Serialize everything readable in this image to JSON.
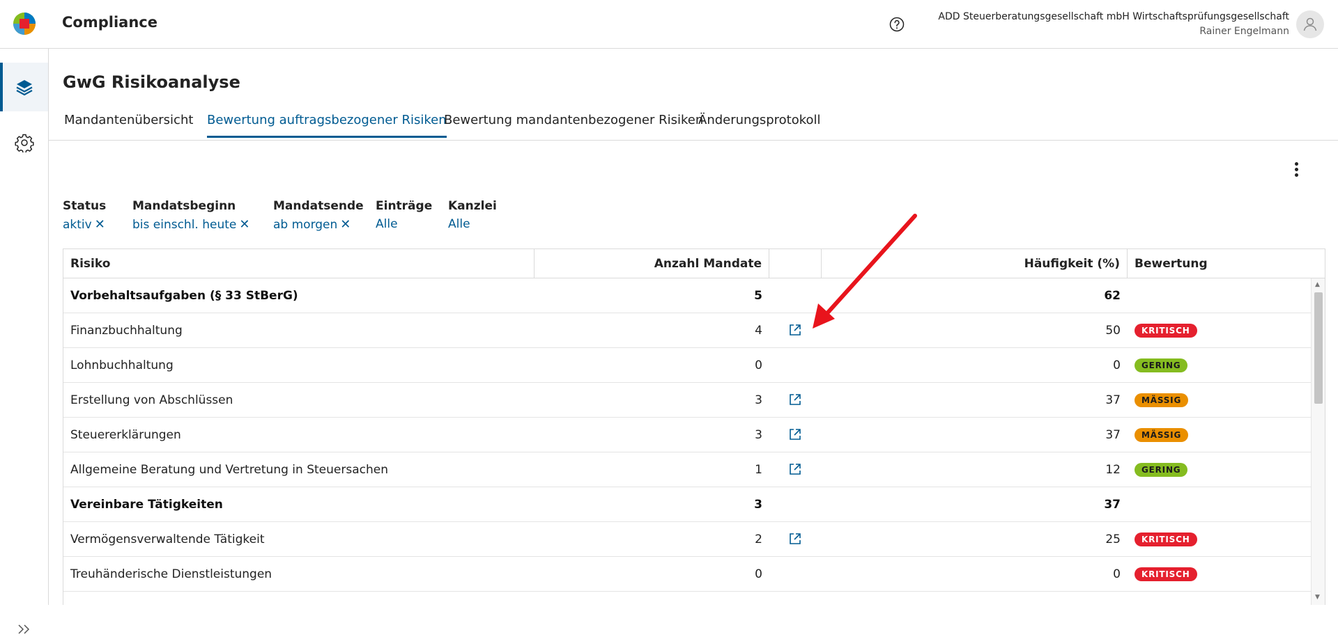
{
  "header": {
    "app_title": "Compliance",
    "company": "ADD Steuerberatungsgesellschaft mbH Wirtschaftsprüfungsgesellschaft",
    "user": "Rainer Engelmann"
  },
  "page": {
    "title": "GwG Risikoanalyse"
  },
  "tabs": [
    {
      "label": "Mandantenübersicht"
    },
    {
      "label": "Bewertung auftragsbezogener Risiken"
    },
    {
      "label": "Bewertung mandantenbezogener Risiken"
    },
    {
      "label": "Änderungsprotokoll"
    }
  ],
  "active_tab": "Bewertung auftragsbezogener Risiken",
  "filters": [
    {
      "label": "Status",
      "value": "aktiv",
      "clearable": true
    },
    {
      "label": "Mandatsbeginn",
      "value": "bis einschl. heute",
      "clearable": true
    },
    {
      "label": "Mandatsende",
      "value": "ab morgen",
      "clearable": true
    },
    {
      "label": "Einträge",
      "value": "Alle",
      "clearable": false
    },
    {
      "label": "Kanzlei",
      "value": "Alle",
      "clearable": false
    }
  ],
  "table": {
    "columns": {
      "risk": "Risiko",
      "count": "Anzahl Mandate",
      "link": "",
      "frequency": "Häufigkeit (%)",
      "rating": "Bewertung"
    },
    "rows": [
      {
        "risk": "Vorbehaltsaufgaben (§ 33 StBerG)",
        "count": "5",
        "link": false,
        "frequency": "62",
        "rating": "",
        "group": true
      },
      {
        "risk": "Finanzbuchhaltung",
        "count": "4",
        "link": true,
        "frequency": "50",
        "rating": "KRITISCH",
        "group": false
      },
      {
        "risk": "Lohnbuchhaltung",
        "count": "0",
        "link": false,
        "frequency": "0",
        "rating": "GERING",
        "group": false
      },
      {
        "risk": "Erstellung von Abschlüssen",
        "count": "3",
        "link": true,
        "frequency": "37",
        "rating": "MÄSSIG",
        "group": false
      },
      {
        "risk": "Steuererklärungen",
        "count": "3",
        "link": true,
        "frequency": "37",
        "rating": "MÄSSIG",
        "group": false
      },
      {
        "risk": "Allgemeine Beratung und Vertretung in Steuersachen",
        "count": "1",
        "link": true,
        "frequency": "12",
        "rating": "GERING",
        "group": false
      },
      {
        "risk": "Vereinbare Tätigkeiten",
        "count": "3",
        "link": false,
        "frequency": "37",
        "rating": "",
        "group": true
      },
      {
        "risk": "Vermögensverwaltende Tätigkeit",
        "count": "2",
        "link": true,
        "frequency": "25",
        "rating": "KRITISCH",
        "group": false
      },
      {
        "risk": "Treuhänderische Dienstleistungen",
        "count": "0",
        "link": false,
        "frequency": "0",
        "rating": "KRITISCH",
        "group": false
      }
    ]
  },
  "colors": {
    "accent": "#005b92",
    "kritisch": "#e5202e",
    "gering": "#85bc20",
    "maessig": "#ea8f00",
    "annotation_arrow": "#e8141c"
  },
  "icons": [
    "logo",
    "help-icon",
    "avatar-icon",
    "layers-icon",
    "gear-icon",
    "expand-icon",
    "kebab-icon",
    "close-icon",
    "external-link-icon",
    "red-arrow-annotation"
  ]
}
